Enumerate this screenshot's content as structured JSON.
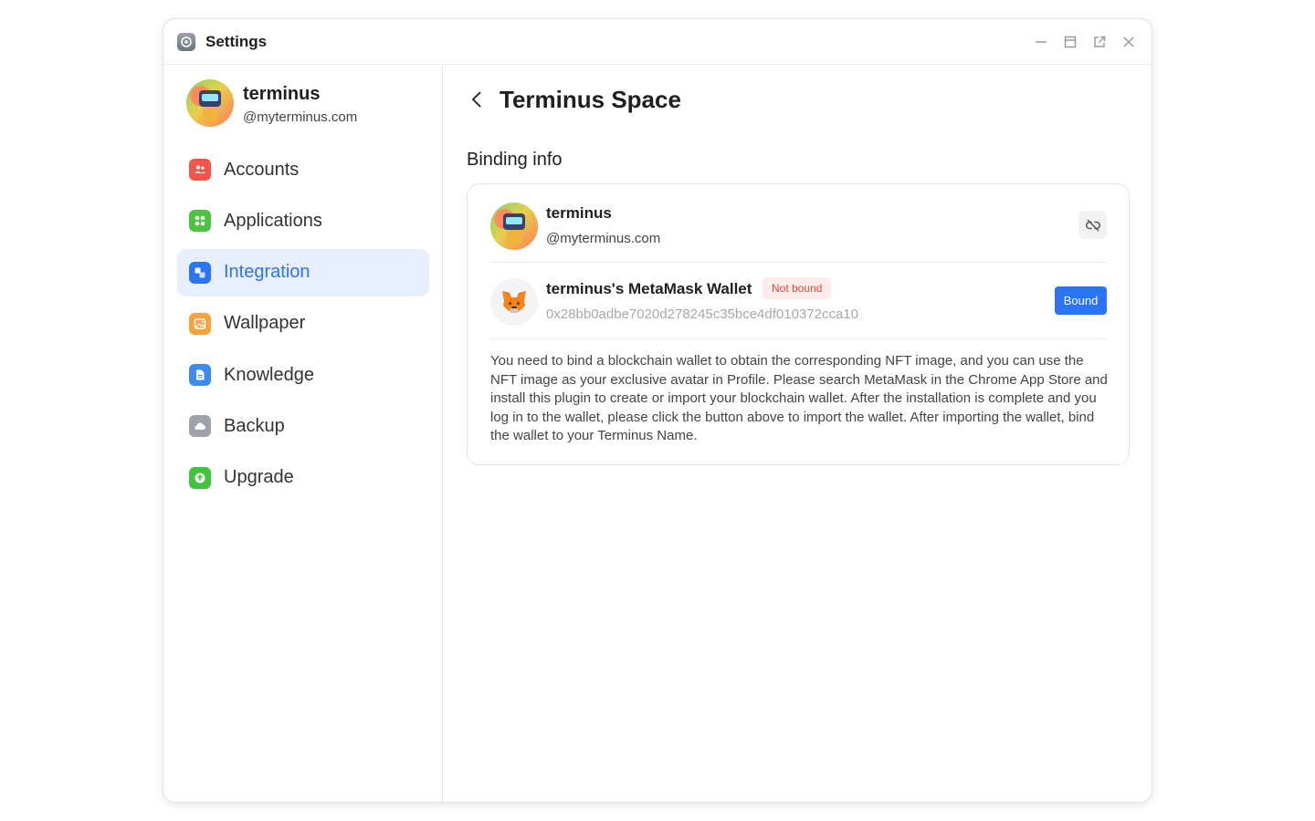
{
  "window": {
    "title": "Settings",
    "controls": [
      "minimize-icon",
      "maximize-icon",
      "popout-icon",
      "close-icon"
    ]
  },
  "profile": {
    "name": "terminus",
    "domain": "@myterminus.com"
  },
  "sidebar": {
    "items": [
      {
        "label": "Accounts",
        "icon": "accounts-icon",
        "color": "#f2564a",
        "active": false
      },
      {
        "label": "Applications",
        "icon": "applications-icon",
        "color": "#4cc43f",
        "active": false
      },
      {
        "label": "Integration",
        "icon": "integration-icon",
        "color": "#2b74f5",
        "active": true
      },
      {
        "label": "Wallpaper",
        "icon": "wallpaper-icon",
        "color": "#f5a33c",
        "active": false
      },
      {
        "label": "Knowledge",
        "icon": "knowledge-icon",
        "color": "#3d8bf2",
        "active": false
      },
      {
        "label": "Backup",
        "icon": "backup-icon",
        "color": "#9ea3aa",
        "active": false
      },
      {
        "label": "Upgrade",
        "icon": "upgrade-icon",
        "color": "#3fc43a",
        "active": false
      }
    ]
  },
  "main": {
    "page_title": "Terminus Space",
    "section_title": "Binding info",
    "account": {
      "name": "terminus",
      "domain": "@myterminus.com"
    },
    "wallet": {
      "name": "terminus's MetaMask Wallet",
      "status": "Not bound",
      "address": "0x28bb0adbe7020d278245c35bce4df010372cca10",
      "button_label": "Bound"
    },
    "description": "You need to bind a blockchain wallet to obtain the corresponding NFT image, and you can use the NFT image as your exclusive avatar in Profile. Please search MetaMask in the Chrome App Store and install this plugin to create or import your blockchain wallet. After the installation is complete and you log in to the wallet, please click the button above to import the wallet. After importing the wallet, bind the wallet to your Terminus Name."
  },
  "colors": {
    "accent": "#2b74f5",
    "active_bg": "#e7efff",
    "badge_bg": "#fdeceb",
    "badge_text": "#e5483b"
  }
}
